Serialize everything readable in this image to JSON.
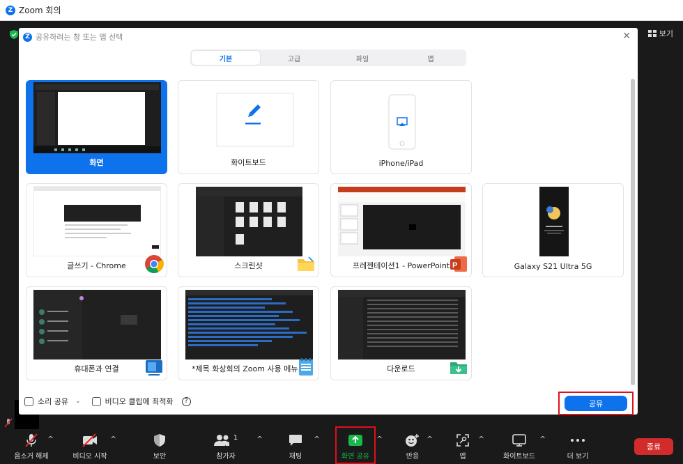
{
  "window": {
    "title": "Zoom 회의"
  },
  "top_right": {
    "view_label": "보기"
  },
  "dialog": {
    "title": "공유하려는 창 또는 앱 선택",
    "tabs": [
      {
        "label": "기본",
        "active": true
      },
      {
        "label": "고급",
        "active": false
      },
      {
        "label": "파일",
        "active": false
      },
      {
        "label": "앱",
        "active": false
      }
    ],
    "cards": [
      {
        "label": "화면",
        "selected": true
      },
      {
        "label": "화이트보드"
      },
      {
        "label": "iPhone/iPad"
      },
      {
        "label": "글쓰기 - Chrome",
        "app_icon": "chrome-icon"
      },
      {
        "label": "스크린샷",
        "app_icon": "folder-icon"
      },
      {
        "label": "프레젠테이션1 - PowerPoint",
        "app_icon": "powerpoint-icon"
      },
      {
        "label": "Galaxy S21 Ultra 5G"
      },
      {
        "label": "휴대폰과 연결",
        "app_icon": "phone-link-icon"
      },
      {
        "label": "*제목 화상회의 Zoom 사용 메뉴...",
        "app_icon": "notepad-icon"
      },
      {
        "label": "다운로드",
        "app_icon": "download-folder-icon"
      }
    ],
    "options": {
      "sound_share": "소리 공유",
      "optimize_video": "비디오 클립에 최적화"
    },
    "share_button": "공유"
  },
  "toolbar": {
    "items": [
      {
        "label": "음소거 해제",
        "icon": "mic-muted-icon"
      },
      {
        "label": "비디오 시작",
        "icon": "video-off-icon"
      },
      {
        "label": "보안",
        "icon": "security-shield-icon"
      },
      {
        "label": "참가자",
        "icon": "participants-icon",
        "count": "1"
      },
      {
        "label": "채팅",
        "icon": "chat-icon"
      },
      {
        "label": "화면 공유",
        "icon": "share-screen-icon"
      },
      {
        "label": "반응",
        "icon": "reaction-icon"
      },
      {
        "label": "앱",
        "icon": "apps-icon"
      },
      {
        "label": "화이트보드",
        "icon": "whiteboard-icon"
      },
      {
        "label": "더 보기",
        "icon": "more-icon"
      }
    ],
    "end_label": "종료"
  },
  "colors": {
    "accent": "#0e72ed",
    "danger": "#d22b2b",
    "share_green": "#19b84a",
    "highlight_frame": "#e0101a"
  }
}
